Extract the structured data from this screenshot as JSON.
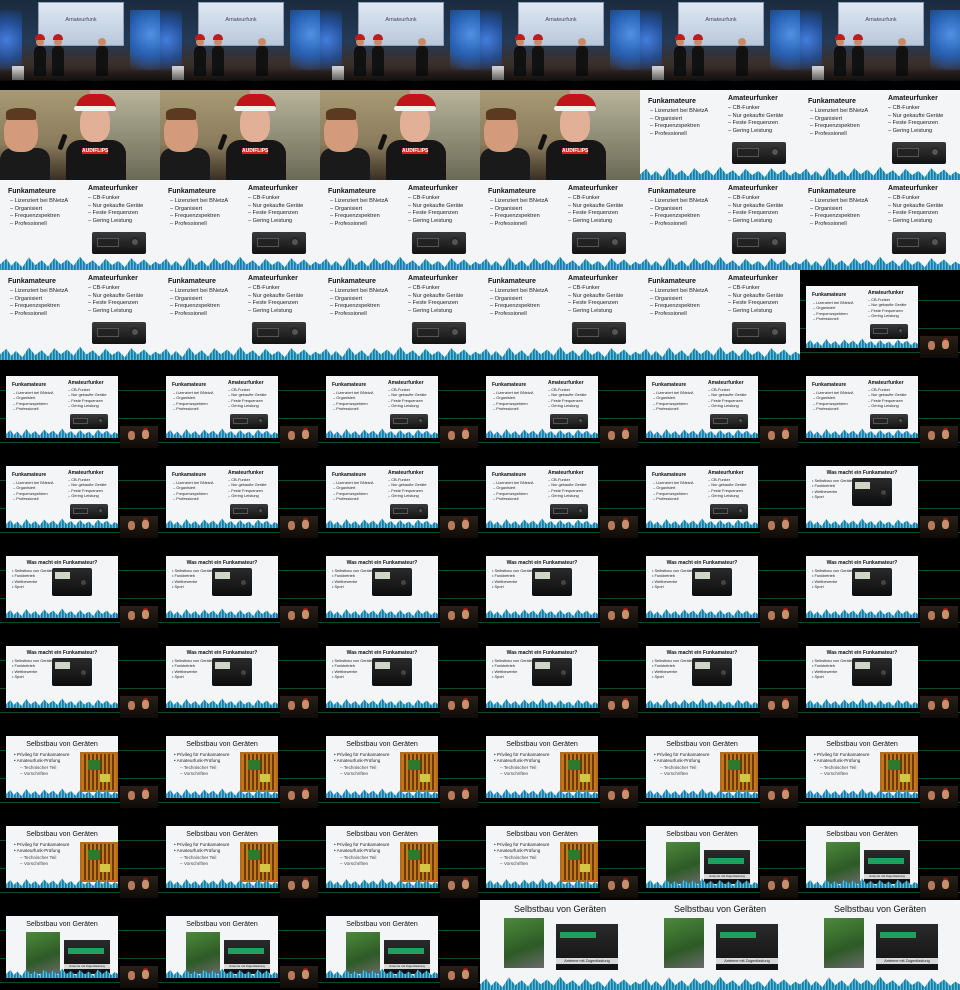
{
  "sheet": {
    "columns": 6,
    "rows": 11
  },
  "stage": {
    "screen_title": "Amateurfunk"
  },
  "speaker_shirt": "AUDIFLIPS",
  "slides": {
    "A": {
      "left_title": "Funkamateure",
      "left_items": [
        "Lizenziert bei BNetzA",
        "Organisiert",
        "Frequenzspektren",
        "Professionell"
      ],
      "right_title": "Amateurfunker",
      "right_items": [
        "CB-Funker",
        "Nur gekaufte Geräte",
        "Feste Frequenzen",
        "Gering Leistung"
      ]
    },
    "B": {
      "title": "Was macht ein Funkamateur?",
      "items": [
        "Selbstbau von Geräten",
        "Funkbetrieb",
        "Wettbewerbe",
        "Sport"
      ]
    },
    "C": {
      "title": "Selbstbau von Geräten",
      "items": [
        "Privileg für Funkamateure",
        "Amateurfunk-Prüfung"
      ],
      "sub_items": [
        "Technischer Teil",
        "Vorschriften"
      ]
    },
    "D": {
      "title": "Selbstbau von Geräten",
      "photo_caption": "Antenne mit Zugentlastung"
    }
  },
  "cells": [
    "stage",
    "stage",
    "stage",
    "stage",
    "stage",
    "stage",
    "closeup",
    "closeup",
    "closeup",
    "closeup",
    "A-full",
    "A-full",
    "A-full",
    "A-full",
    "A-full",
    "A-full",
    "A-full",
    "A-full",
    "A-full",
    "A-full",
    "A-full",
    "A-full",
    "A-full",
    "A-pip",
    "A-pip",
    "A-pip",
    "A-pip",
    "A-pip",
    "A-pip",
    "A-pip",
    "A-pip",
    "A-pip",
    "A-pip",
    "A-pip",
    "A-pip",
    "B-pip",
    "B-pip",
    "B-pip",
    "B-pip",
    "B-pip",
    "B-pip",
    "B-pip",
    "B-pip",
    "B-pip",
    "B-pip",
    "B-pip",
    "B-pip",
    "B-pip",
    "C-pip",
    "C-pip",
    "C-pip",
    "C-pip",
    "C-pip",
    "C-pip",
    "C-pip",
    "C-pip",
    "C-pip",
    "C-pip",
    "D-pip",
    "D-pip",
    "D-pip",
    "D-pip",
    "D-pip",
    "D-full",
    "D-full",
    "D-full"
  ]
}
